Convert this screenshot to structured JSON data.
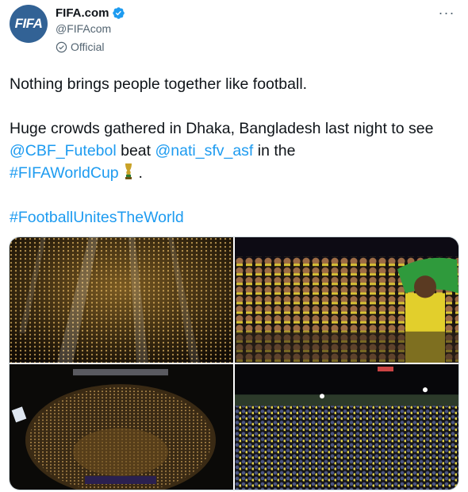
{
  "author": {
    "avatar_text": "FIFA",
    "display_name": "FIFA.com",
    "handle": "@FIFAcom",
    "label": "Official"
  },
  "tweet": {
    "line1": "Nothing brings people together like football.",
    "line2_prefix": "Huge crowds gathered in Dhaka, Bangladesh last night to see ",
    "mention1": "@CBF_Futebol",
    "beat": " beat ",
    "mention2": "@nati_sfv_asf",
    "in_the": " in the",
    "hashtag1": "#FIFAWorldCup",
    "trophy_emoji": "trophy",
    "period": " .",
    "hashtag2": "#FootballUnitesTheWorld"
  },
  "colors": {
    "link": "#1d9bf0",
    "avatar_bg": "#326295",
    "verified": "#1d9bf0"
  },
  "media": {
    "images": [
      "stadium-crowd-lights",
      "fans-celebrating-flag",
      "stadium-aerial-night",
      "outdoor-crowd-screen"
    ]
  }
}
